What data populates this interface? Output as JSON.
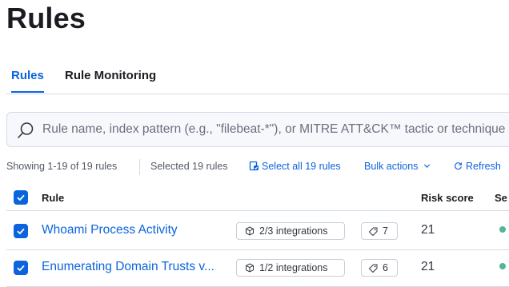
{
  "page": {
    "title": "Rules"
  },
  "tabs": [
    {
      "label": "Rules",
      "active": true
    },
    {
      "label": "Rule Monitoring",
      "active": false
    }
  ],
  "search": {
    "placeholder": "Rule name, index pattern (e.g., \"filebeat-*\"), or MITRE ATT&CK™ tactic or technique"
  },
  "utility": {
    "showing": "Showing 1-19 of 19 rules",
    "selected": "Selected 19 rules",
    "select_all": "Select all 19 rules",
    "bulk_actions": "Bulk actions",
    "bulk_actions_icon": "chevron-down-icon",
    "refresh": "Refresh",
    "refresh_icon": "refresh-icon"
  },
  "table": {
    "columns": {
      "rule": "Rule",
      "risk_score": "Risk score",
      "severity": "Se"
    },
    "rows": [
      {
        "name": "Whoami Process Activity",
        "integrations": "2/3 integrations",
        "tags": "7",
        "risk_score": "21",
        "severity_color": "#54b399"
      },
      {
        "name": "Enumerating Domain Trusts v...",
        "integrations": "1/2 integrations",
        "tags": "6",
        "risk_score": "21",
        "severity_color": "#54b399"
      }
    ]
  },
  "colors": {
    "accent": "#0b64dd",
    "border": "#d3dae6",
    "severity_low": "#54b399"
  }
}
